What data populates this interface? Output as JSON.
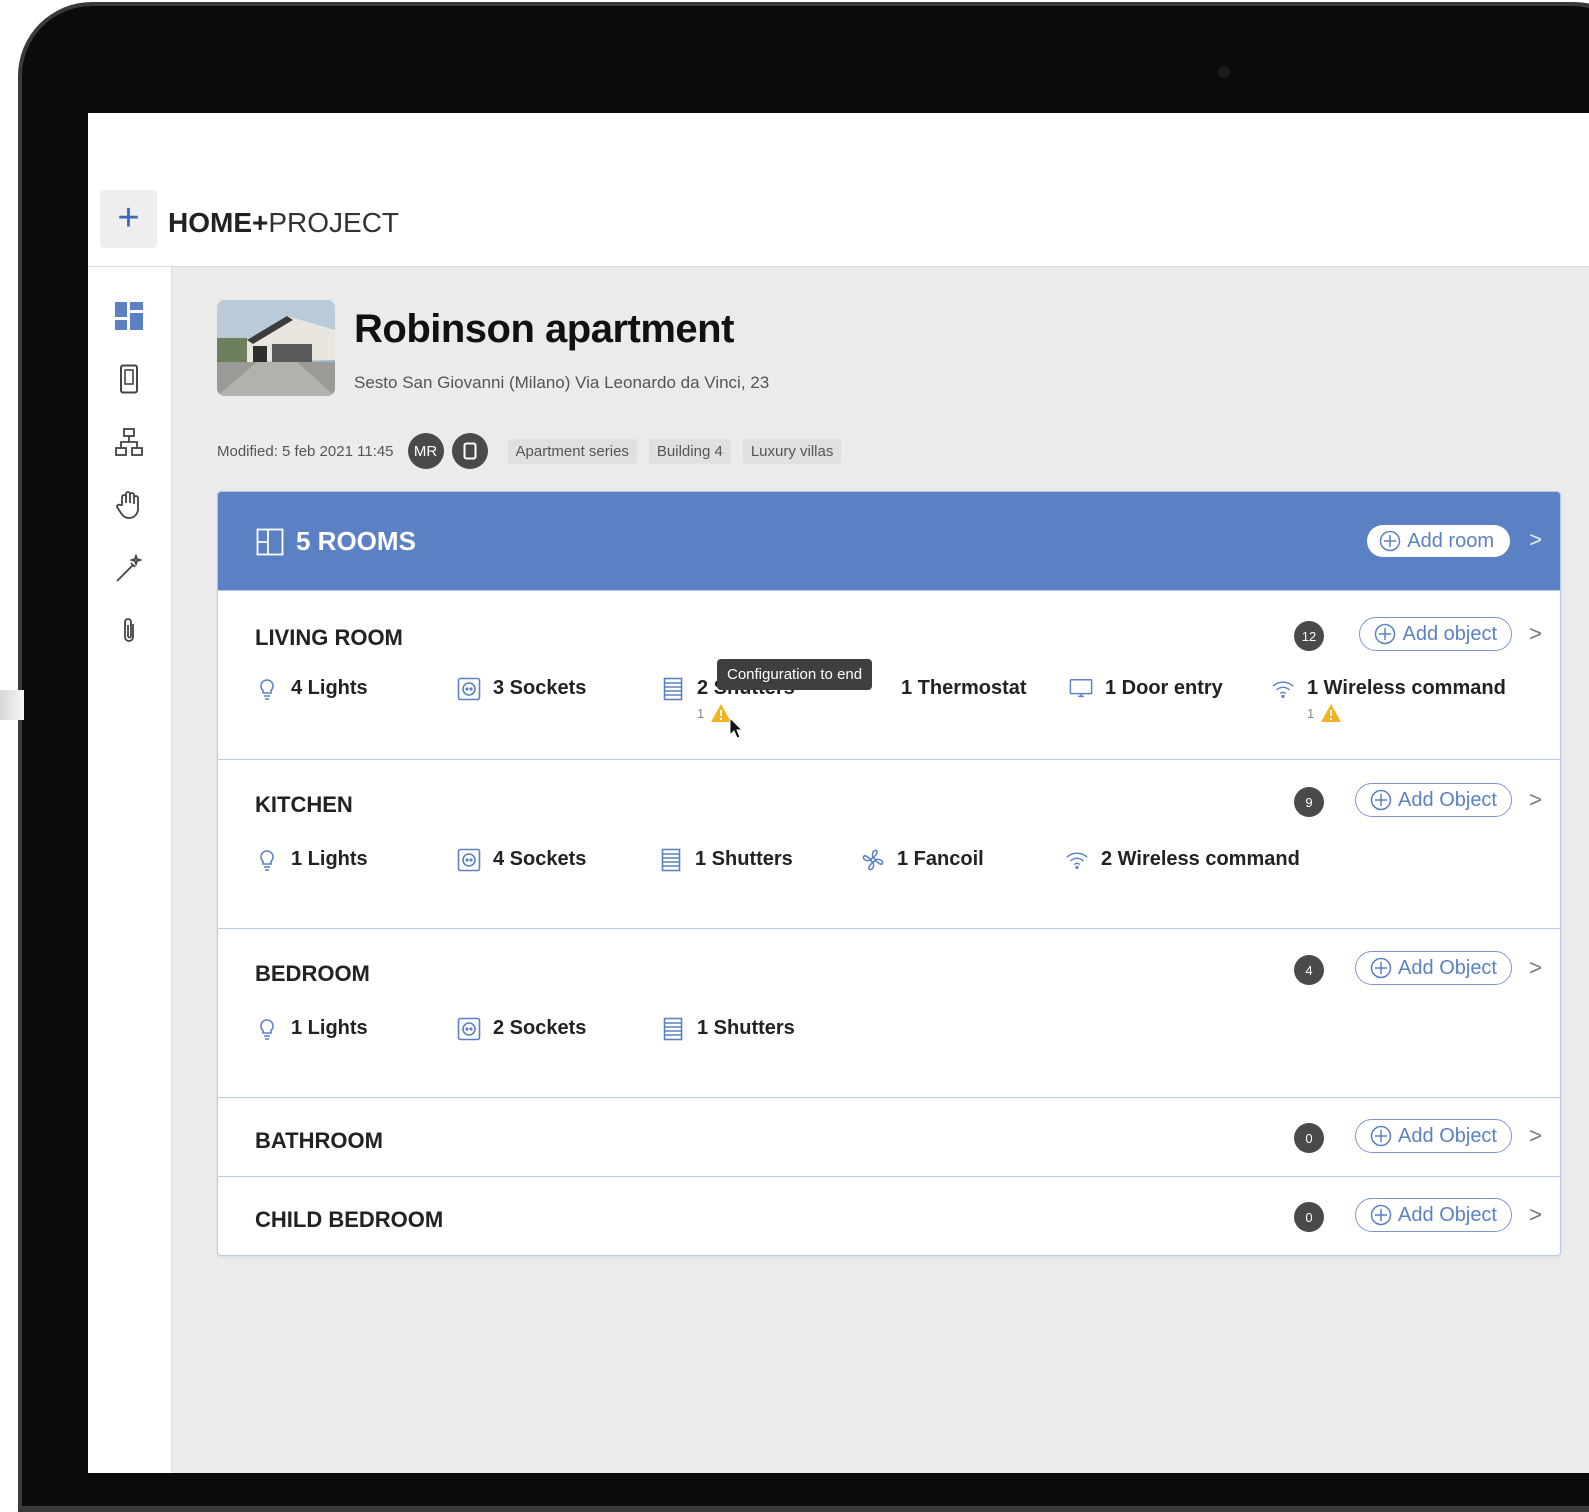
{
  "app": {
    "name_bold": "HOME+",
    "name_light": "PROJECT",
    "logo_glyph": "+"
  },
  "colors": {
    "accent": "#5b81c4",
    "header_bg": "#5b81c4",
    "badge": "#4a4a4a",
    "warning": "#f2b322"
  },
  "sidebar": {
    "items": [
      {
        "icon": "dashboard-icon"
      },
      {
        "icon": "device-icon"
      },
      {
        "icon": "hierarchy-icon"
      },
      {
        "icon": "hand-icon"
      },
      {
        "icon": "magic-wand-icon"
      },
      {
        "icon": "attachment-icon"
      }
    ]
  },
  "project": {
    "title": "Robinson apartment",
    "address": "Sesto San Giovanni (Milano) Via Leonardo da Vinci, 23",
    "modified": "Modified: 5 feb 2021 11:45",
    "avatar_initials": "MR",
    "tags": [
      "Apartment series",
      "Building 4",
      "Luxury villas"
    ]
  },
  "rooms_panel": {
    "title": "5 ROOMS",
    "add_room_label": "Add room",
    "chevron": ">"
  },
  "tooltip": {
    "text": "Configuration to end"
  },
  "rooms": [
    {
      "name": "LIVING ROOM",
      "count": "12",
      "add_label": "Add object",
      "items": [
        {
          "icon": "light-bulb-icon",
          "label": "4 Lights"
        },
        {
          "icon": "socket-icon",
          "label": "3 Sockets"
        },
        {
          "icon": "shutter-icon",
          "label": "2 Shutters",
          "warning_count": "1"
        },
        {
          "icon": "thermostat-icon",
          "label": "1 Thermostat"
        },
        {
          "icon": "door-entry-icon",
          "label": "1 Door entry"
        },
        {
          "icon": "wireless-icon",
          "label": "1 Wireless command",
          "warning_count": "1"
        }
      ]
    },
    {
      "name": "KITCHEN",
      "count": "9",
      "add_label": "Add Object",
      "items": [
        {
          "icon": "light-bulb-icon",
          "label": "1 Lights"
        },
        {
          "icon": "socket-icon",
          "label": "4 Sockets"
        },
        {
          "icon": "shutter-icon",
          "label": "1 Shutters"
        },
        {
          "icon": "fancoil-icon",
          "label": "1 Fancoil"
        },
        {
          "icon": "wireless-icon",
          "label": "2 Wireless command"
        }
      ]
    },
    {
      "name": "BEDROOM",
      "count": "4",
      "add_label": "Add Object",
      "items": [
        {
          "icon": "light-bulb-icon",
          "label": "1 Lights"
        },
        {
          "icon": "socket-icon",
          "label": "2 Sockets"
        },
        {
          "icon": "shutter-icon",
          "label": "1 Shutters"
        }
      ]
    },
    {
      "name": "BATHROOM",
      "count": "0",
      "add_label": "Add Object",
      "items": []
    },
    {
      "name": "CHILD BEDROOM",
      "count": "0",
      "add_label": "Add Object",
      "items": []
    }
  ]
}
